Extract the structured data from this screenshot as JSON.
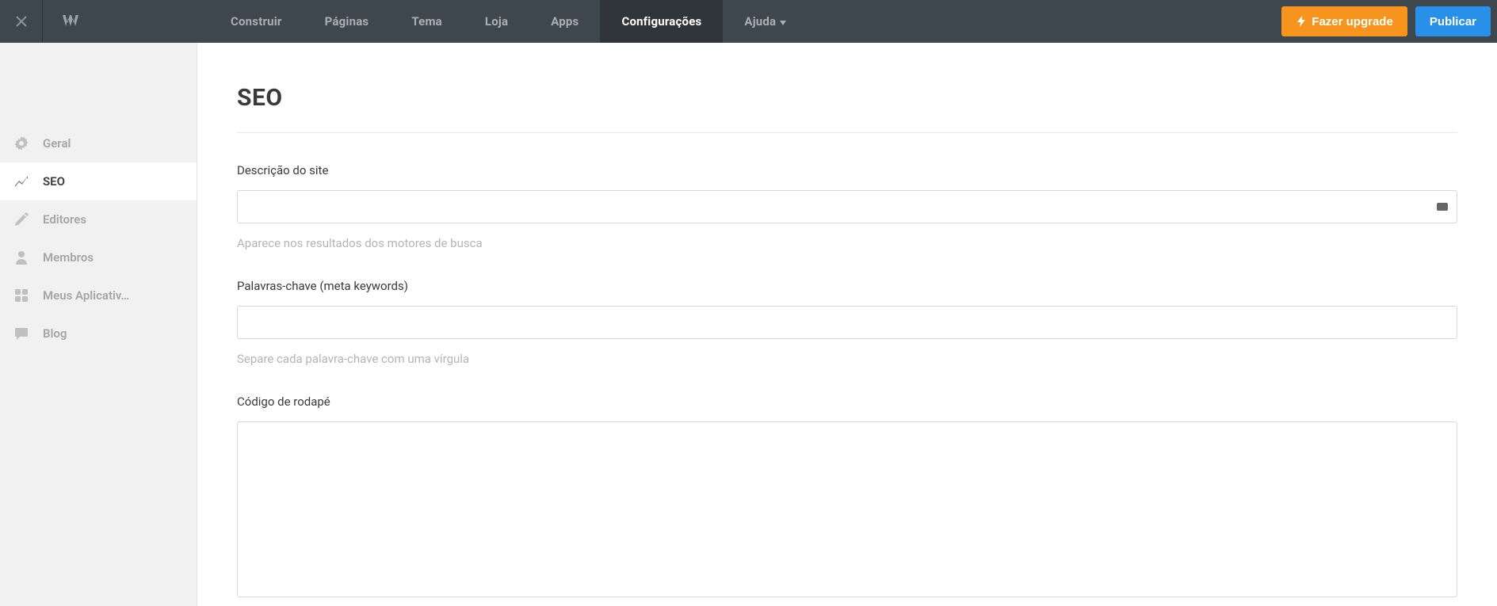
{
  "topbar": {
    "nav": [
      {
        "label": "Construir"
      },
      {
        "label": "Páginas"
      },
      {
        "label": "Tema"
      },
      {
        "label": "Loja"
      },
      {
        "label": "Apps"
      },
      {
        "label": "Configurações",
        "active": true
      },
      {
        "label": "Ajuda",
        "dropdown": true
      }
    ],
    "upgrade_label": "Fazer upgrade",
    "publish_label": "Publicar"
  },
  "sidebar": {
    "items": [
      {
        "label": "Geral",
        "icon": "gear"
      },
      {
        "label": "SEO",
        "icon": "trend",
        "active": true
      },
      {
        "label": "Editores",
        "icon": "pencil"
      },
      {
        "label": "Membros",
        "icon": "user"
      },
      {
        "label": "Meus Aplicativ…",
        "icon": "apps"
      },
      {
        "label": "Blog",
        "icon": "chat"
      }
    ]
  },
  "main": {
    "title": "SEO",
    "fields": {
      "site_desc": {
        "label": "Descrição do site",
        "value": "",
        "hint": "Aparece nos resultados dos motores de busca"
      },
      "keywords": {
        "label": "Palavras-chave (meta keywords)",
        "value": "",
        "hint": "Separe cada palavra-chave com uma vírgula"
      },
      "footer_code": {
        "label": "Código de rodapé",
        "value": ""
      }
    }
  }
}
